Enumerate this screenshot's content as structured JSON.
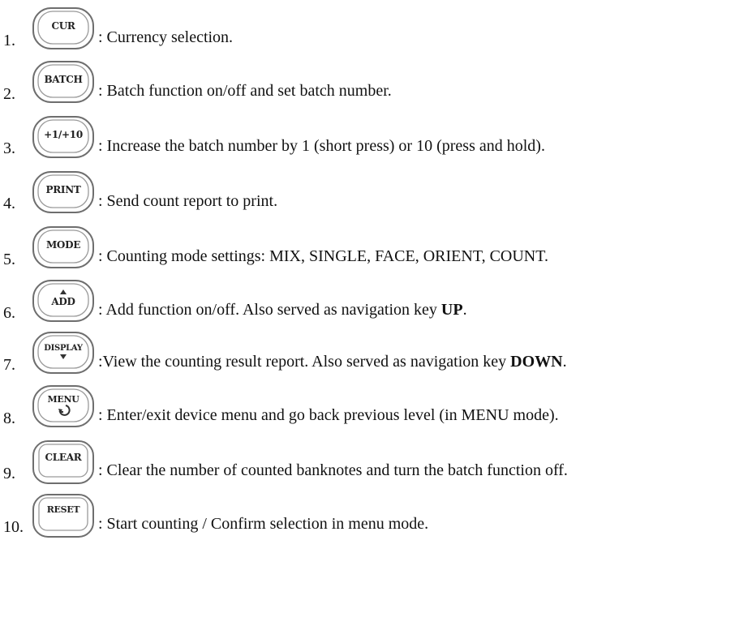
{
  "items": [
    {
      "number": "1.",
      "key_label": "CUR",
      "icon": "cur-key-icon",
      "description": ": Currency selection.",
      "bold": "",
      "tail": ""
    },
    {
      "number": "2.",
      "key_label": "BATCH",
      "icon": "batch-key-icon",
      "description": ": Batch function on/off and set batch number.",
      "bold": "",
      "tail": ""
    },
    {
      "number": "3.",
      "key_label": "+1/+10",
      "icon": "plus-key-icon",
      "description": ": Increase the batch number by 1 (short press) or 10 (press and hold).",
      "bold": "",
      "tail": ""
    },
    {
      "number": "4.",
      "key_label": "PRINT",
      "icon": "print-key-icon",
      "description": ": Send count report to print.",
      "bold": "",
      "tail": ""
    },
    {
      "number": "5.",
      "key_label": "MODE",
      "icon": "mode-key-icon",
      "description": ": Counting mode settings: MIX, SINGLE, FACE, ORIENT, COUNT.",
      "bold": "",
      "tail": ""
    },
    {
      "number": "6.",
      "key_label": "ADD",
      "icon": "add-up-key-icon",
      "description": ": Add function on/off. Also served as navigation key ",
      "bold": "UP",
      "tail": "."
    },
    {
      "number": "7.",
      "key_label": "DISPLAY",
      "icon": "display-down-key-icon",
      "description": ":View the counting result report. Also served as navigation key ",
      "bold": "DOWN",
      "tail": "."
    },
    {
      "number": "8.",
      "key_label": "MENU",
      "icon": "menu-back-key-icon",
      "description": ": Enter/exit device menu and go back previous level (in MENU mode).",
      "bold": "",
      "tail": ""
    },
    {
      "number": "9.",
      "key_label": "CLEAR",
      "icon": "clear-key-icon",
      "description": ": Clear the number of counted banknotes and turn the batch function off.",
      "bold": "",
      "tail": ""
    },
    {
      "number": "10.",
      "key_label": "RESET",
      "icon": "reset-key-icon",
      "description": ": Start counting / Confirm selection in menu mode.",
      "bold": "",
      "tail": ""
    }
  ]
}
